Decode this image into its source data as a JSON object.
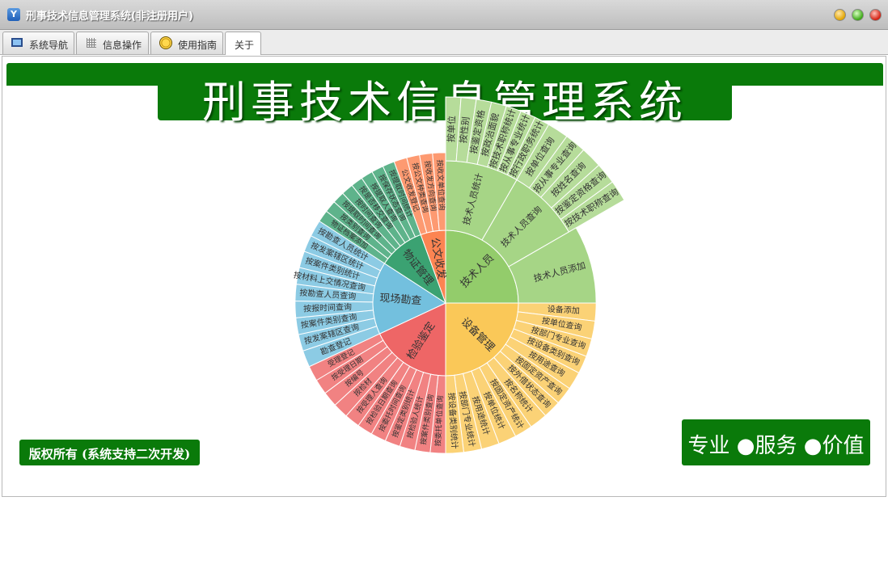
{
  "window": {
    "title": "刑事技术信息管理系统(非注册用户)",
    "app_icon": "app-logo-icon"
  },
  "tabs": [
    {
      "label": "系统导航",
      "icon": "monitor-icon"
    },
    {
      "label": "信息操作",
      "icon": "grid-icon"
    },
    {
      "label": "使用指南",
      "icon": "guide-icon"
    },
    {
      "label": "关于",
      "active": true
    }
  ],
  "banner": {
    "title": "刑事技术信息管理系统"
  },
  "slogan": "专业 ●服务 ●价值",
  "copyright": "版权所有 (系统支持二次开发)",
  "colors": {
    "brand_green": "#0a7a0a"
  },
  "sunburst": {
    "segments": [
      {
        "name": "技术人员",
        "color": "#93cc6b",
        "children": [
          {
            "name": "技术人员统计",
            "children": [
              "按单位",
              "按性别",
              "按鉴定资格",
              "按政治面貌",
              "按技术职称统计",
              "按从事专业统计",
              "按行政职务统计"
            ]
          },
          {
            "name": "技术人员查询",
            "children": [
              "按单位查询",
              "按从事专业查询",
              "按姓名查询",
              "按鉴定资格查询",
              "按技术职称查询"
            ]
          },
          {
            "name": "技术人员添加",
            "children": []
          }
        ]
      },
      {
        "name": "设备管理",
        "color": "#fac858",
        "children": [
          {
            "name": "设备添加",
            "children": []
          },
          {
            "name": "按单位查询",
            "children": []
          },
          {
            "name": "按部门专业查询",
            "children": []
          },
          {
            "name": "按设备类别查询",
            "children": []
          },
          {
            "name": "按用途查询",
            "children": []
          },
          {
            "name": "按固定资产查询",
            "children": []
          },
          {
            "name": "按外借状态查询",
            "children": []
          },
          {
            "name": "按名称统计",
            "children": []
          },
          {
            "name": "按固定资产统计",
            "children": []
          },
          {
            "name": "按单位统计",
            "children": []
          },
          {
            "name": "按用途统计",
            "children": []
          },
          {
            "name": "按部门专业统计",
            "children": []
          },
          {
            "name": "按设备类别统计",
            "children": []
          }
        ]
      },
      {
        "name": "检验鉴定",
        "color": "#ee6666",
        "children": [
          {
            "name": "按委托单位查询",
            "children": []
          },
          {
            "name": "按案件类别查询",
            "children": []
          },
          {
            "name": "按检验人统计",
            "children": []
          },
          {
            "name": "按鉴定类别统计",
            "children": []
          },
          {
            "name": "按委托时间查询",
            "children": []
          },
          {
            "name": "按检验日期查询",
            "children": []
          },
          {
            "name": "按受理人查询",
            "children": []
          },
          {
            "name": "按检材",
            "children": []
          },
          {
            "name": "按编号",
            "children": []
          },
          {
            "name": "按受理日期",
            "children": []
          },
          {
            "name": "受理登记",
            "children": []
          }
        ]
      },
      {
        "name": "现场勘查",
        "color": "#73c0de",
        "children": [
          {
            "name": "勘查登记",
            "children": []
          },
          {
            "name": "按发案辖区查询",
            "children": []
          },
          {
            "name": "按案件类别查询",
            "children": []
          },
          {
            "name": "按报时间查询",
            "children": []
          },
          {
            "name": "按勘查人员查询",
            "children": []
          },
          {
            "name": "按材料上交情况查询",
            "children": []
          },
          {
            "name": "按案件类别统计",
            "children": []
          },
          {
            "name": "按发案辖区统计",
            "children": []
          },
          {
            "name": "按勘查人员统计",
            "children": []
          }
        ]
      },
      {
        "name": "物证管理",
        "color": "#3ba272",
        "children": [
          {
            "name": "物证档案添加",
            "children": []
          },
          {
            "name": "按类别查询",
            "children": []
          },
          {
            "name": "按提取时间查询",
            "children": []
          },
          {
            "name": "按时间查询",
            "children": []
          },
          {
            "name": "按是否移交查询",
            "children": []
          },
          {
            "name": "按提取人查询",
            "children": []
          },
          {
            "name": "按保存状态查询",
            "children": []
          },
          {
            "name": "按提取时间统计",
            "children": []
          }
        ]
      },
      {
        "name": "公文收发",
        "color": "#fc8452",
        "children": [
          {
            "name": "公文收发登记",
            "children": []
          },
          {
            "name": "按公文种类查询",
            "children": []
          },
          {
            "name": "按收发方向查询",
            "children": []
          },
          {
            "name": "按收文单位查询",
            "children": []
          }
        ]
      }
    ]
  }
}
